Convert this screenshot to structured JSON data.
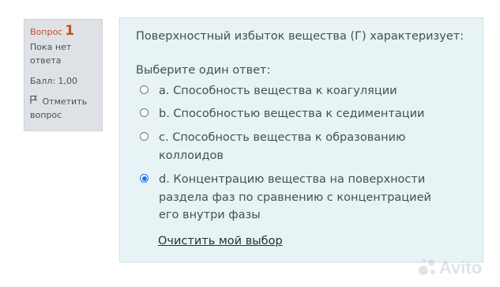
{
  "info": {
    "question_label": "Вопрос",
    "question_number": "1",
    "state": "Пока нет ответа",
    "grade": "Балл: 1,00",
    "flag_label": "Отметить вопрос"
  },
  "question": {
    "text": "Поверхностный избыток вещества (Г) характеризует:",
    "prompt": "Выберите один ответ:",
    "answers": [
      {
        "label": "a. Способность вещества  к коагуляции",
        "checked": false
      },
      {
        "label": "b. Способностью вещества к седиментации",
        "checked": false
      },
      {
        "label": "c. Способность вещества к образованию коллоидов",
        "checked": false
      },
      {
        "label": "d. Концентрацию вещества на поверхности раздела фаз по сравнению с концентрацией его внутри фазы",
        "checked": true
      }
    ],
    "clear_label": "Очистить мой выбор"
  },
  "watermark": {
    "text": "Avito",
    "icon": "avito-logo-icon"
  },
  "colors": {
    "question_number": "#c2531f",
    "info_bg": "#dee2e6",
    "content_bg": "#e7f3f5",
    "radio_checked": "#1a73e8"
  }
}
